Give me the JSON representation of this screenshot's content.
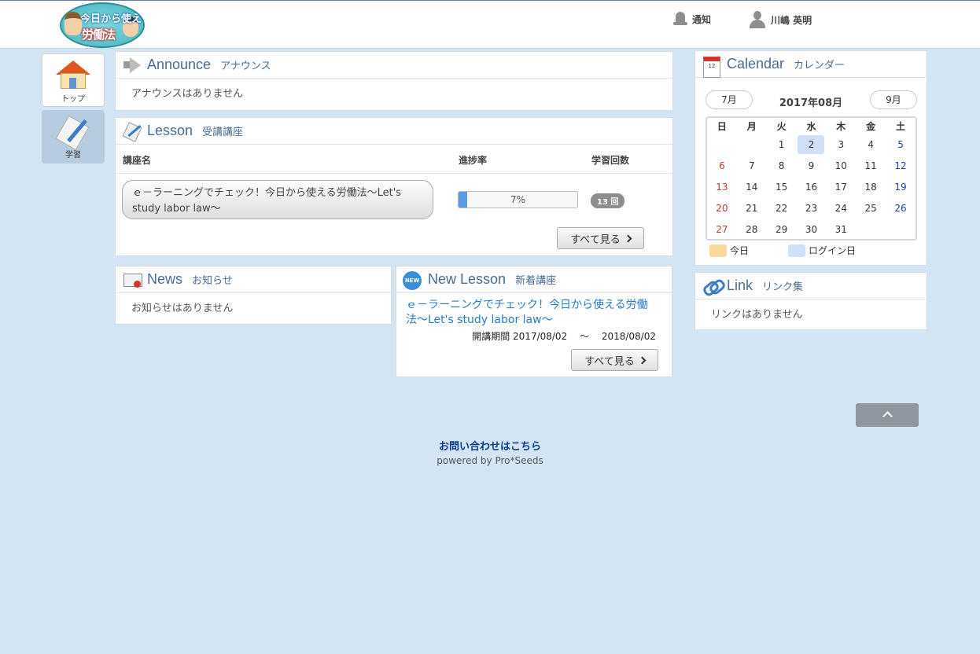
{
  "header": {
    "logo_today": "今日から使える",
    "logo_title": "労働法",
    "notify_label": "通知",
    "user_name": "川嶋 英明"
  },
  "nav": {
    "home_label": "トップ",
    "study_label": "学習"
  },
  "announce": {
    "title": "Announce",
    "subtitle": "アナウンス",
    "empty": "アナウンスはありません"
  },
  "lesson": {
    "title": "Lesson",
    "subtitle": "受講講座",
    "col_course": "講座名",
    "col_progress": "進捗率",
    "col_count": "学習回数",
    "rows": [
      {
        "course": "ｅ－ラーニングでチェック！今日から使える労働法～Let's study labor law～",
        "progress_label": "7%",
        "progress": 0.07,
        "count": "13 回"
      }
    ],
    "view_all": "すべて見る"
  },
  "news": {
    "title": "News",
    "subtitle": "お知らせ",
    "empty": "お知らせはありません"
  },
  "new_lesson": {
    "title": "New Lesson",
    "subtitle": "新着講座",
    "course": "ｅ－ラーニングでチェック！今日から使える労働法～Let's study labor law～",
    "period": "開講期間 2017/08/02　 ～　 2018/08/02",
    "view_all": "すべて見る"
  },
  "calendar": {
    "title": "Calendar",
    "subtitle": "カレンダー",
    "prev": "7月",
    "next": "9月",
    "month": "2017年08月",
    "weekdays": [
      "日",
      "月",
      "火",
      "水",
      "木",
      "金",
      "土"
    ],
    "weeks": [
      [
        "",
        "",
        "1",
        "2",
        "3",
        "4",
        "5"
      ],
      [
        "6",
        "7",
        "8",
        "9",
        "10",
        "11",
        "12"
      ],
      [
        "13",
        "14",
        "15",
        "16",
        "17",
        "18",
        "19"
      ],
      [
        "20",
        "21",
        "22",
        "23",
        "24",
        "25",
        "26"
      ],
      [
        "27",
        "28",
        "29",
        "30",
        "31",
        "",
        ""
      ]
    ],
    "login_day": "2",
    "legend_today": "今日",
    "legend_login": "ログイン日",
    "today_color": "#fbd99b",
    "login_color": "#cfe0f7"
  },
  "link": {
    "title": "Link",
    "subtitle": "リンク集",
    "empty": "リンクはありません"
  },
  "footer": {
    "contact": "お問い合わせはこちら",
    "powered": "powered by Pro*Seeds"
  }
}
